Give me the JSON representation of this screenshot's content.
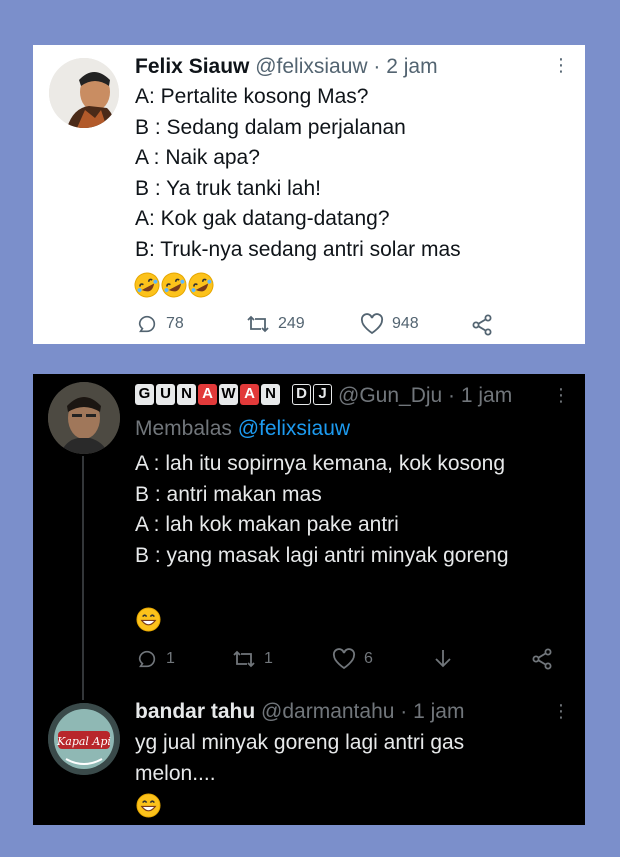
{
  "tweet1": {
    "name": "Felix Siauw",
    "handle": "@felixsiauw",
    "time": "· 2 jam",
    "lines": [
      "A: Pertalite kosong Mas?",
      "B : Sedang dalam perjalanan",
      "A : Naik apa?",
      "B : Ya truk tanki lah!",
      "A: Kok gak datang-datang?",
      "B: Truk-nya sedang antri solar mas"
    ],
    "emojis": [
      "rolling-on-floor-laughing",
      "rolling-on-floor-laughing",
      "rolling-on-floor-laughing"
    ],
    "replies": "78",
    "retweets": "249",
    "likes": "948"
  },
  "tweet2": {
    "name_letters": [
      "G",
      "U",
      "N",
      "A",
      "W",
      "A",
      "N",
      "",
      "D",
      "J"
    ],
    "handle": "@Gun_Dju",
    "time": "· 1 jam",
    "replying_prefix": "Membalas",
    "replying_to": "@felixsiauw",
    "lines": [
      "A : lah itu sopirnya kemana, kok kosong",
      "B : antri makan mas",
      "A : lah kok makan pake antri",
      "B : yang masak lagi antri minyak goreng"
    ],
    "emoji": "grinning-face",
    "replies": "1",
    "retweets": "1",
    "likes": "6"
  },
  "tweet3": {
    "name": "bandar tahu",
    "handle": "@darmantahu",
    "time": "· 1 jam",
    "lines": [
      "yg jual minyak goreng lagi antri gas",
      "melon...."
    ],
    "emoji": "grinning-face",
    "avatar_logo_text": "Kapal Api"
  },
  "colors": {
    "background": "#7b8fcb",
    "link_blue": "#1d9bf0",
    "muted_light": "#536471",
    "muted_dark": "#71767b"
  }
}
